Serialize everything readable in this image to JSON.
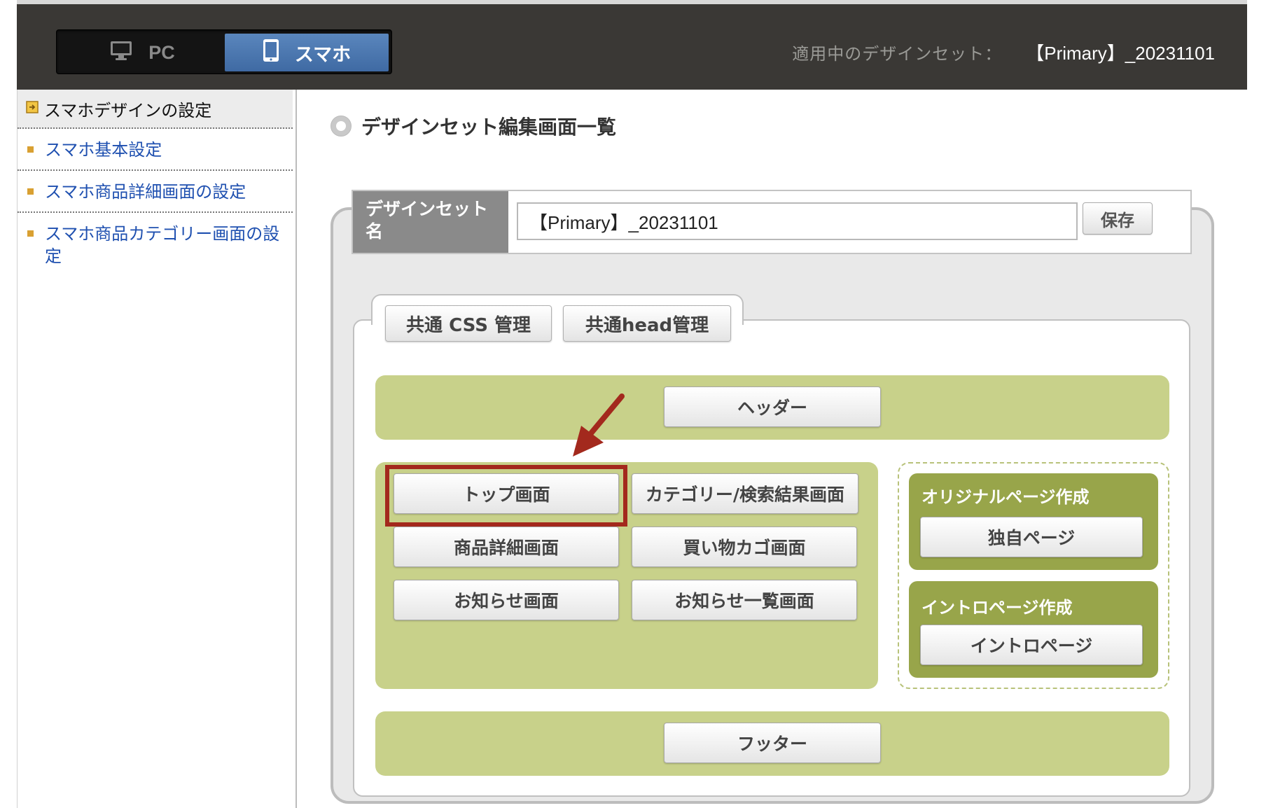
{
  "header": {
    "device_tabs": [
      {
        "label": "PC",
        "icon": "monitor-icon",
        "selected": false
      },
      {
        "label": "スマホ",
        "icon": "smartphone-icon",
        "selected": true
      }
    ],
    "applied_label": "適用中のデザインセット：",
    "applied_value": "【Primary】_20231101"
  },
  "sidebar": {
    "heading": "スマホデザインの設定",
    "items": [
      {
        "label": "スマホ基本設定"
      },
      {
        "label": "スマホ商品詳細画面の設定"
      },
      {
        "label": "スマホ商品カテゴリー画面の設定"
      }
    ]
  },
  "main": {
    "title": "デザインセット編集画面一覧",
    "design_set_label": "デザインセット名",
    "design_set_value": "【Primary】_20231101",
    "save_label": "保存",
    "tabs": [
      {
        "label": "共通 CSS 管理"
      },
      {
        "label": "共通head管理"
      }
    ],
    "header_button": "ヘッダー",
    "page_buttons": [
      {
        "label": "トップ画面"
      },
      {
        "label": "カテゴリー/検索結果画面"
      },
      {
        "label": "商品詳細画面"
      },
      {
        "label": "買い物カゴ画面"
      },
      {
        "label": "お知らせ画面"
      },
      {
        "label": "お知らせ一覧画面"
      }
    ],
    "original_page": {
      "title": "オリジナルページ作成",
      "button": "独自ページ"
    },
    "intro_page": {
      "title": "イントロページ作成",
      "button": "イントロページ"
    },
    "footer_button": "フッター"
  },
  "colors": {
    "topbar": "#3a3835",
    "selected_tab": "#4a76b0",
    "link": "#1f50b0",
    "green_panel": "#c8d18a",
    "olive_panel": "#98a54a",
    "highlight": "#a3291d"
  }
}
